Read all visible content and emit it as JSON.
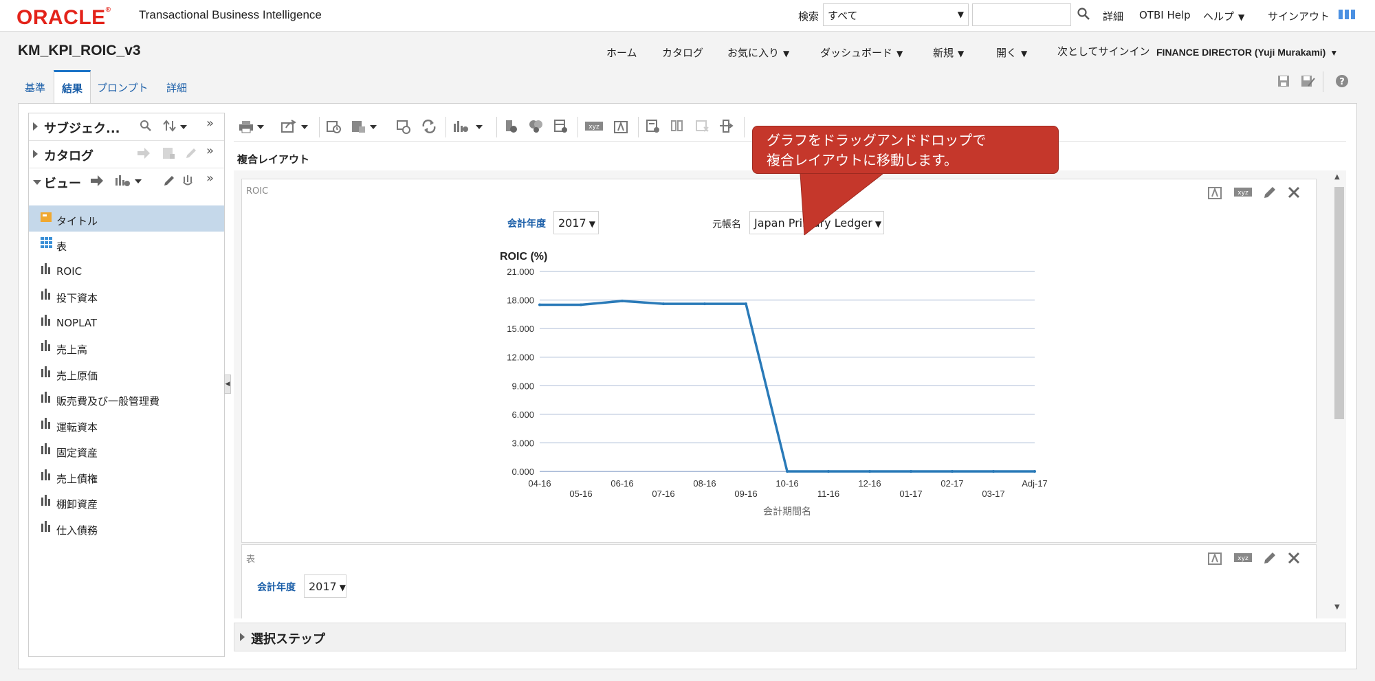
{
  "header": {
    "logo_text": "ORACLE",
    "logo_reg": "®",
    "app_title": "Transactional Business Intelligence",
    "search_label": "検索",
    "search_scope": "すべて",
    "search_placeholder": "",
    "detail_link": "詳細",
    "otbi_help": "OTBI Help",
    "help_menu": "ヘルプ",
    "signout": "サインアウト"
  },
  "page": {
    "title": "KM_KPI_ROIC_v3"
  },
  "nav": {
    "home": "ホーム",
    "catalog": "カタログ",
    "favorites": "お気に入り",
    "dashboard": "ダッシュボード",
    "new": "新規",
    "open": "開く",
    "signed_in_as": "次としてサインイン",
    "user": "FINANCE DIRECTOR (Yuji Murakami)"
  },
  "tabs": {
    "criteria": "基準",
    "results": "結果",
    "prompts": "プロンプト",
    "advanced": "詳細"
  },
  "left_pane": {
    "subject": "サブジェク...",
    "catalog": "カタログ",
    "views": "ビュー",
    "view_items": [
      {
        "label": "タイトル",
        "icon": "title-icon"
      },
      {
        "label": "表",
        "icon": "table-icon"
      },
      {
        "label": "ROIC",
        "icon": "chart-icon"
      },
      {
        "label": "投下資本",
        "icon": "chart-icon"
      },
      {
        "label": "NOPLAT",
        "icon": "chart-icon"
      },
      {
        "label": "売上高",
        "icon": "chart-icon"
      },
      {
        "label": "売上原価",
        "icon": "chart-icon"
      },
      {
        "label": "販売費及び一般管理費",
        "icon": "chart-icon"
      },
      {
        "label": "運転資本",
        "icon": "chart-icon"
      },
      {
        "label": "固定資産",
        "icon": "chart-icon"
      },
      {
        "label": "売上債権",
        "icon": "chart-icon"
      },
      {
        "label": "棚卸資産",
        "icon": "chart-icon"
      },
      {
        "label": "仕入債務",
        "icon": "chart-icon"
      }
    ]
  },
  "main": {
    "compound_layout": "複合レイアウト",
    "roic_view": {
      "caption": "ROIC",
      "fiscal_year_label": "会計年度",
      "fiscal_year_value": "2017",
      "ledger_label": "元帳名",
      "ledger_value": "Japan Primary Ledger"
    },
    "table_view": {
      "caption": "表",
      "fiscal_year_label": "会計年度",
      "fiscal_year_value": "2017"
    },
    "selection_steps": "選択ステップ"
  },
  "callout": {
    "line1": "グラフをドラッグアンドドロップで",
    "line2": "複合レイアウトに移動します。"
  },
  "chart_data": {
    "type": "line",
    "title": "ROIC (%)",
    "xlabel": "会計期間名",
    "ylabel": "",
    "categories": [
      "04-16",
      "05-16",
      "06-16",
      "07-16",
      "08-16",
      "09-16",
      "10-16",
      "11-16",
      "12-16",
      "01-17",
      "02-17",
      "03-17",
      "Adj-17"
    ],
    "values": [
      17.5,
      17.5,
      17.9,
      17.6,
      17.6,
      17.6,
      0,
      0,
      0,
      0,
      0,
      0,
      0
    ],
    "ylim": [
      0,
      21
    ],
    "yticks": [
      "21.000",
      "18.000",
      "15.000",
      "12.000",
      "9.000",
      "6.000",
      "3.000",
      "0.000"
    ],
    "grid": true,
    "color": "#2a7ab8"
  },
  "colors": {
    "oracle_red": "#e3231a",
    "link_blue": "#1a5ea8",
    "callout": "#c5372b",
    "selected_row": "#c5d8ea"
  }
}
